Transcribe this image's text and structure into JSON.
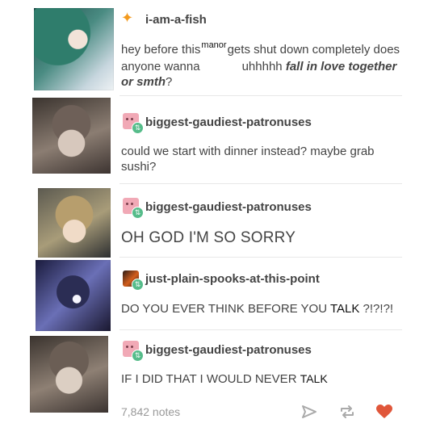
{
  "posts": [
    {
      "username": "i-am-a-fish",
      "text_a": "hey before this",
      "text_manor": "manor",
      "text_b": "gets shut down completely does anyone wanna",
      "text_c": "uhhhhh",
      "text_emph": "fall in love together or smth",
      "text_q": "?"
    },
    {
      "username": "biggest-gaudiest-patronuses",
      "text": "could we start with dinner instead? maybe grab sushi?"
    },
    {
      "username": "biggest-gaudiest-patronuses",
      "text": "OH GOD I'M SO SORRY"
    },
    {
      "username": "just-plain-spooks-at-this-point",
      "text_a": "DO YOU EVER THINK BEFORE YOU",
      "text_b": "TALK",
      "text_c": "?!?!?!"
    },
    {
      "username": "biggest-gaudiest-patronuses",
      "text_a": "IF I DID THAT I WOULD NEVER",
      "text_b": "TALK"
    }
  ],
  "footer": {
    "notes": "7,842 notes",
    "share_icon": "share-icon",
    "reblog_icon": "reblog-icon",
    "like_icon": "heart-icon",
    "like_color": "#e0563a",
    "icon_color": "#aaaaaa"
  }
}
